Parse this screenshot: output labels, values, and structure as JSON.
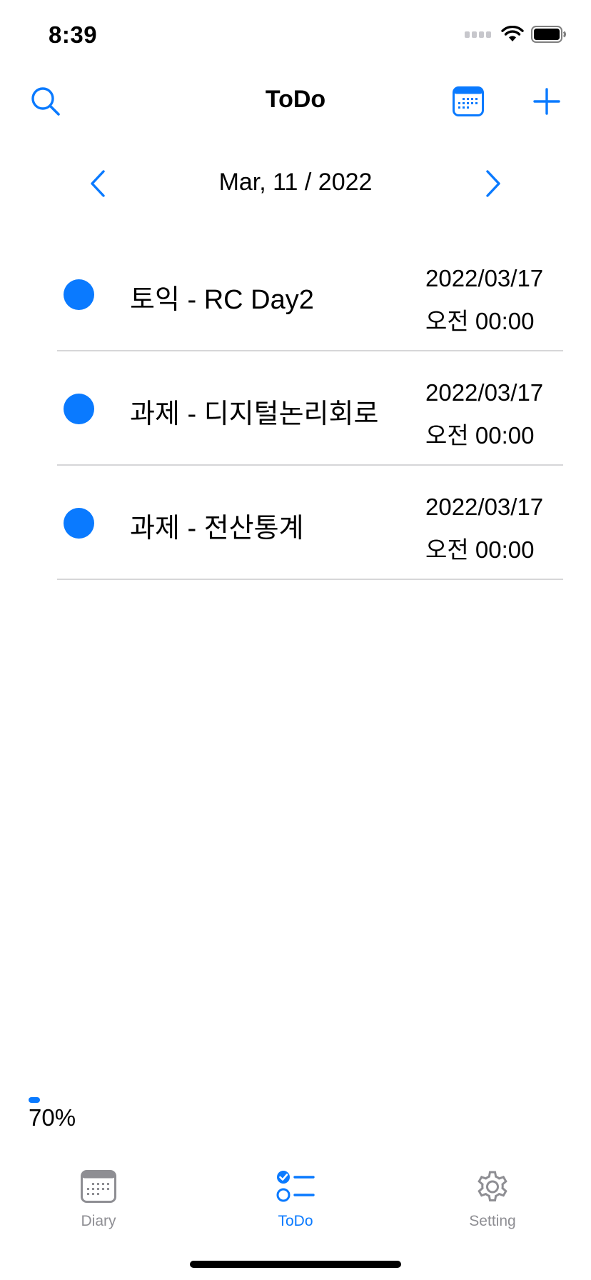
{
  "status_bar": {
    "time": "8:39"
  },
  "nav": {
    "title": "ToDo"
  },
  "date_nav": {
    "date": "Mar, 11 / 2022"
  },
  "todos": [
    {
      "title": "토익 - RC Day2",
      "date": "2022/03/17",
      "time": "오전 00:00"
    },
    {
      "title": "과제 - 디지털논리회로",
      "date": "2022/03/17",
      "time": "오전 00:00"
    },
    {
      "title": "과제 - 전산통계",
      "date": "2022/03/17",
      "time": "오전 00:00"
    }
  ],
  "progress": {
    "label": "70%"
  },
  "tabs": [
    {
      "label": "Diary",
      "icon": "calendar-icon",
      "active": false
    },
    {
      "label": "ToDo",
      "icon": "checklist-icon",
      "active": true
    },
    {
      "label": "Setting",
      "icon": "gear-icon",
      "active": false
    }
  ],
  "colors": {
    "accent": "#0a7aff",
    "inactive": "#8e8e93",
    "divider": "#d6d6d8"
  }
}
